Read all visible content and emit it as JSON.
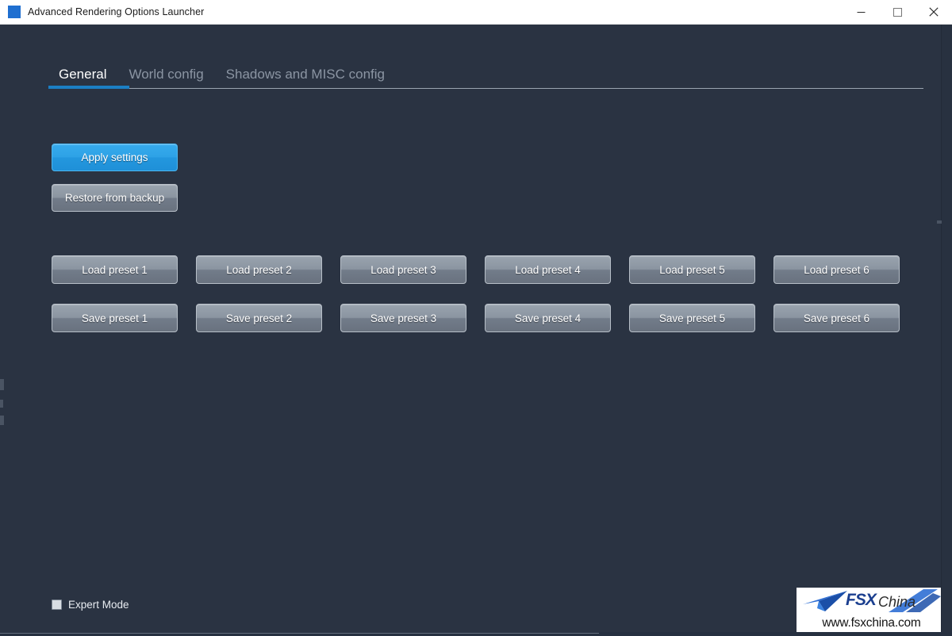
{
  "window": {
    "title": "Advanced Rendering Options Launcher",
    "icon": "app-square-icon",
    "controls": {
      "minimize": "minimize-icon",
      "maximize": "maximize-icon",
      "close": "close-icon"
    }
  },
  "tabs": [
    {
      "label": "General",
      "active": true
    },
    {
      "label": "World config",
      "active": false
    },
    {
      "label": "Shadows and MISC config",
      "active": false
    }
  ],
  "actions": {
    "apply": "Apply settings",
    "restore": "Restore from backup"
  },
  "presets": {
    "load": [
      "Load preset 1",
      "Load preset 2",
      "Load preset 3",
      "Load preset 4",
      "Load preset 5",
      "Load preset 6"
    ],
    "save": [
      "Save preset 1",
      "Save preset 2",
      "Save preset 3",
      "Save preset 4",
      "Save preset 5",
      "Save preset 6"
    ]
  },
  "expert_mode": {
    "label": "Expert Mode",
    "checked": false
  },
  "watermark": {
    "brand_fsx": "FSX",
    "brand_china": "China",
    "url": "www.fsxchina.com"
  },
  "colors": {
    "background": "#2a3342",
    "accent_blue": "#2397de",
    "tab_underline": "#1b7fc4",
    "button_grey_top": "#99a3ae",
    "button_grey_bottom": "#69727f",
    "text_muted": "#8b95a3",
    "text_primary": "#ffffff"
  }
}
